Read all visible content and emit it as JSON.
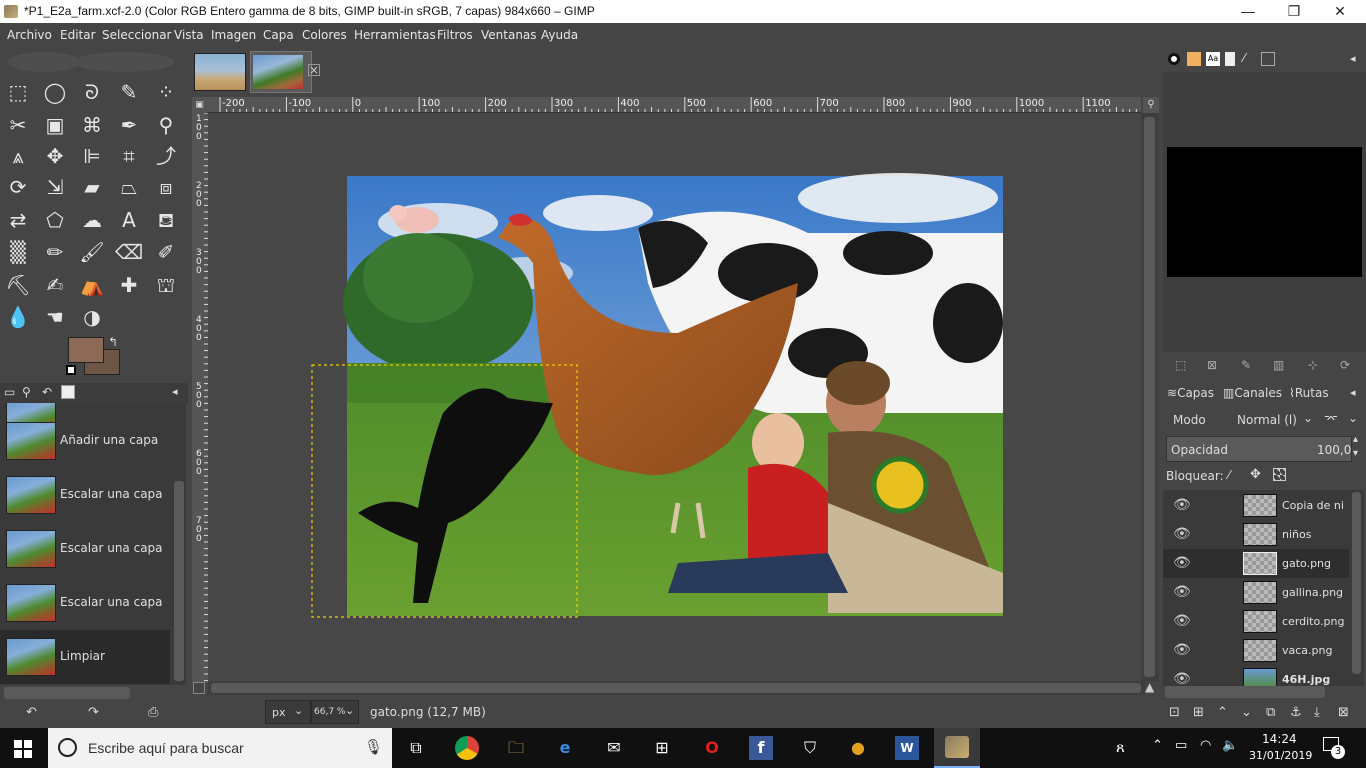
{
  "window": {
    "title": "*P1_E2a_farm.xcf-2.0 (Color RGB Entero gamma de 8 bits, GIMP built-in sRGB, 7 capas) 984x660 – GIMP",
    "minimize": "—",
    "maximize": "❐",
    "close": "✕"
  },
  "menu": [
    "Archivo",
    "Editar",
    "Seleccionar",
    "Vista",
    "Imagen",
    "Capa",
    "Colores",
    "Herramientas",
    "Filtros",
    "Ventanas",
    "Ayuda"
  ],
  "ruler": {
    "h_labels": [
      "-200",
      "-100",
      "0",
      "100",
      "200",
      "300",
      "400",
      "500",
      "600",
      "700",
      "800",
      "900",
      "1000",
      "1100"
    ],
    "v_labels": [
      "1",
      "0",
      "0",
      "2",
      "0",
      "0",
      "3",
      "0",
      "0",
      "4",
      "0",
      "0",
      "5",
      "0",
      "0",
      "6",
      "0",
      "0",
      "7",
      "0",
      "0"
    ]
  },
  "colors": {
    "foreground": "#8d6a57",
    "background": "#6e5647",
    "selection": "#e8d000",
    "accent": "#ffffff"
  },
  "undo_history": {
    "items": [
      "Añadir una capa",
      "Escalar una capa",
      "Escalar una capa",
      "Escalar una capa",
      "Limpiar"
    ],
    "selected_index": 4
  },
  "statusbar": {
    "unit": "px",
    "zoom": "66,7 %",
    "info": "gato.png (12,7 MB)"
  },
  "layers_panel": {
    "tabs": [
      "Capas",
      "Canales",
      "Rutas"
    ],
    "mode_label": "Modo",
    "mode_value": "Normal (l)",
    "opacity_label": "Opacidad",
    "opacity_value": "100,0",
    "lock_label": "Bloquear:",
    "layers": [
      {
        "name": "Copia de ni",
        "bold": false
      },
      {
        "name": "niños",
        "bold": false
      },
      {
        "name": "gato.png",
        "bold": false,
        "selected": true
      },
      {
        "name": "gallina.png",
        "bold": false
      },
      {
        "name": "cerdito.png",
        "bold": false
      },
      {
        "name": "vaca.png",
        "bold": false
      },
      {
        "name": "46H.jpg",
        "bold": true
      }
    ]
  },
  "taskbar": {
    "search_placeholder": "Escribe aquí para buscar",
    "time": "14:24",
    "date": "31/01/2019",
    "notifications": "3"
  }
}
